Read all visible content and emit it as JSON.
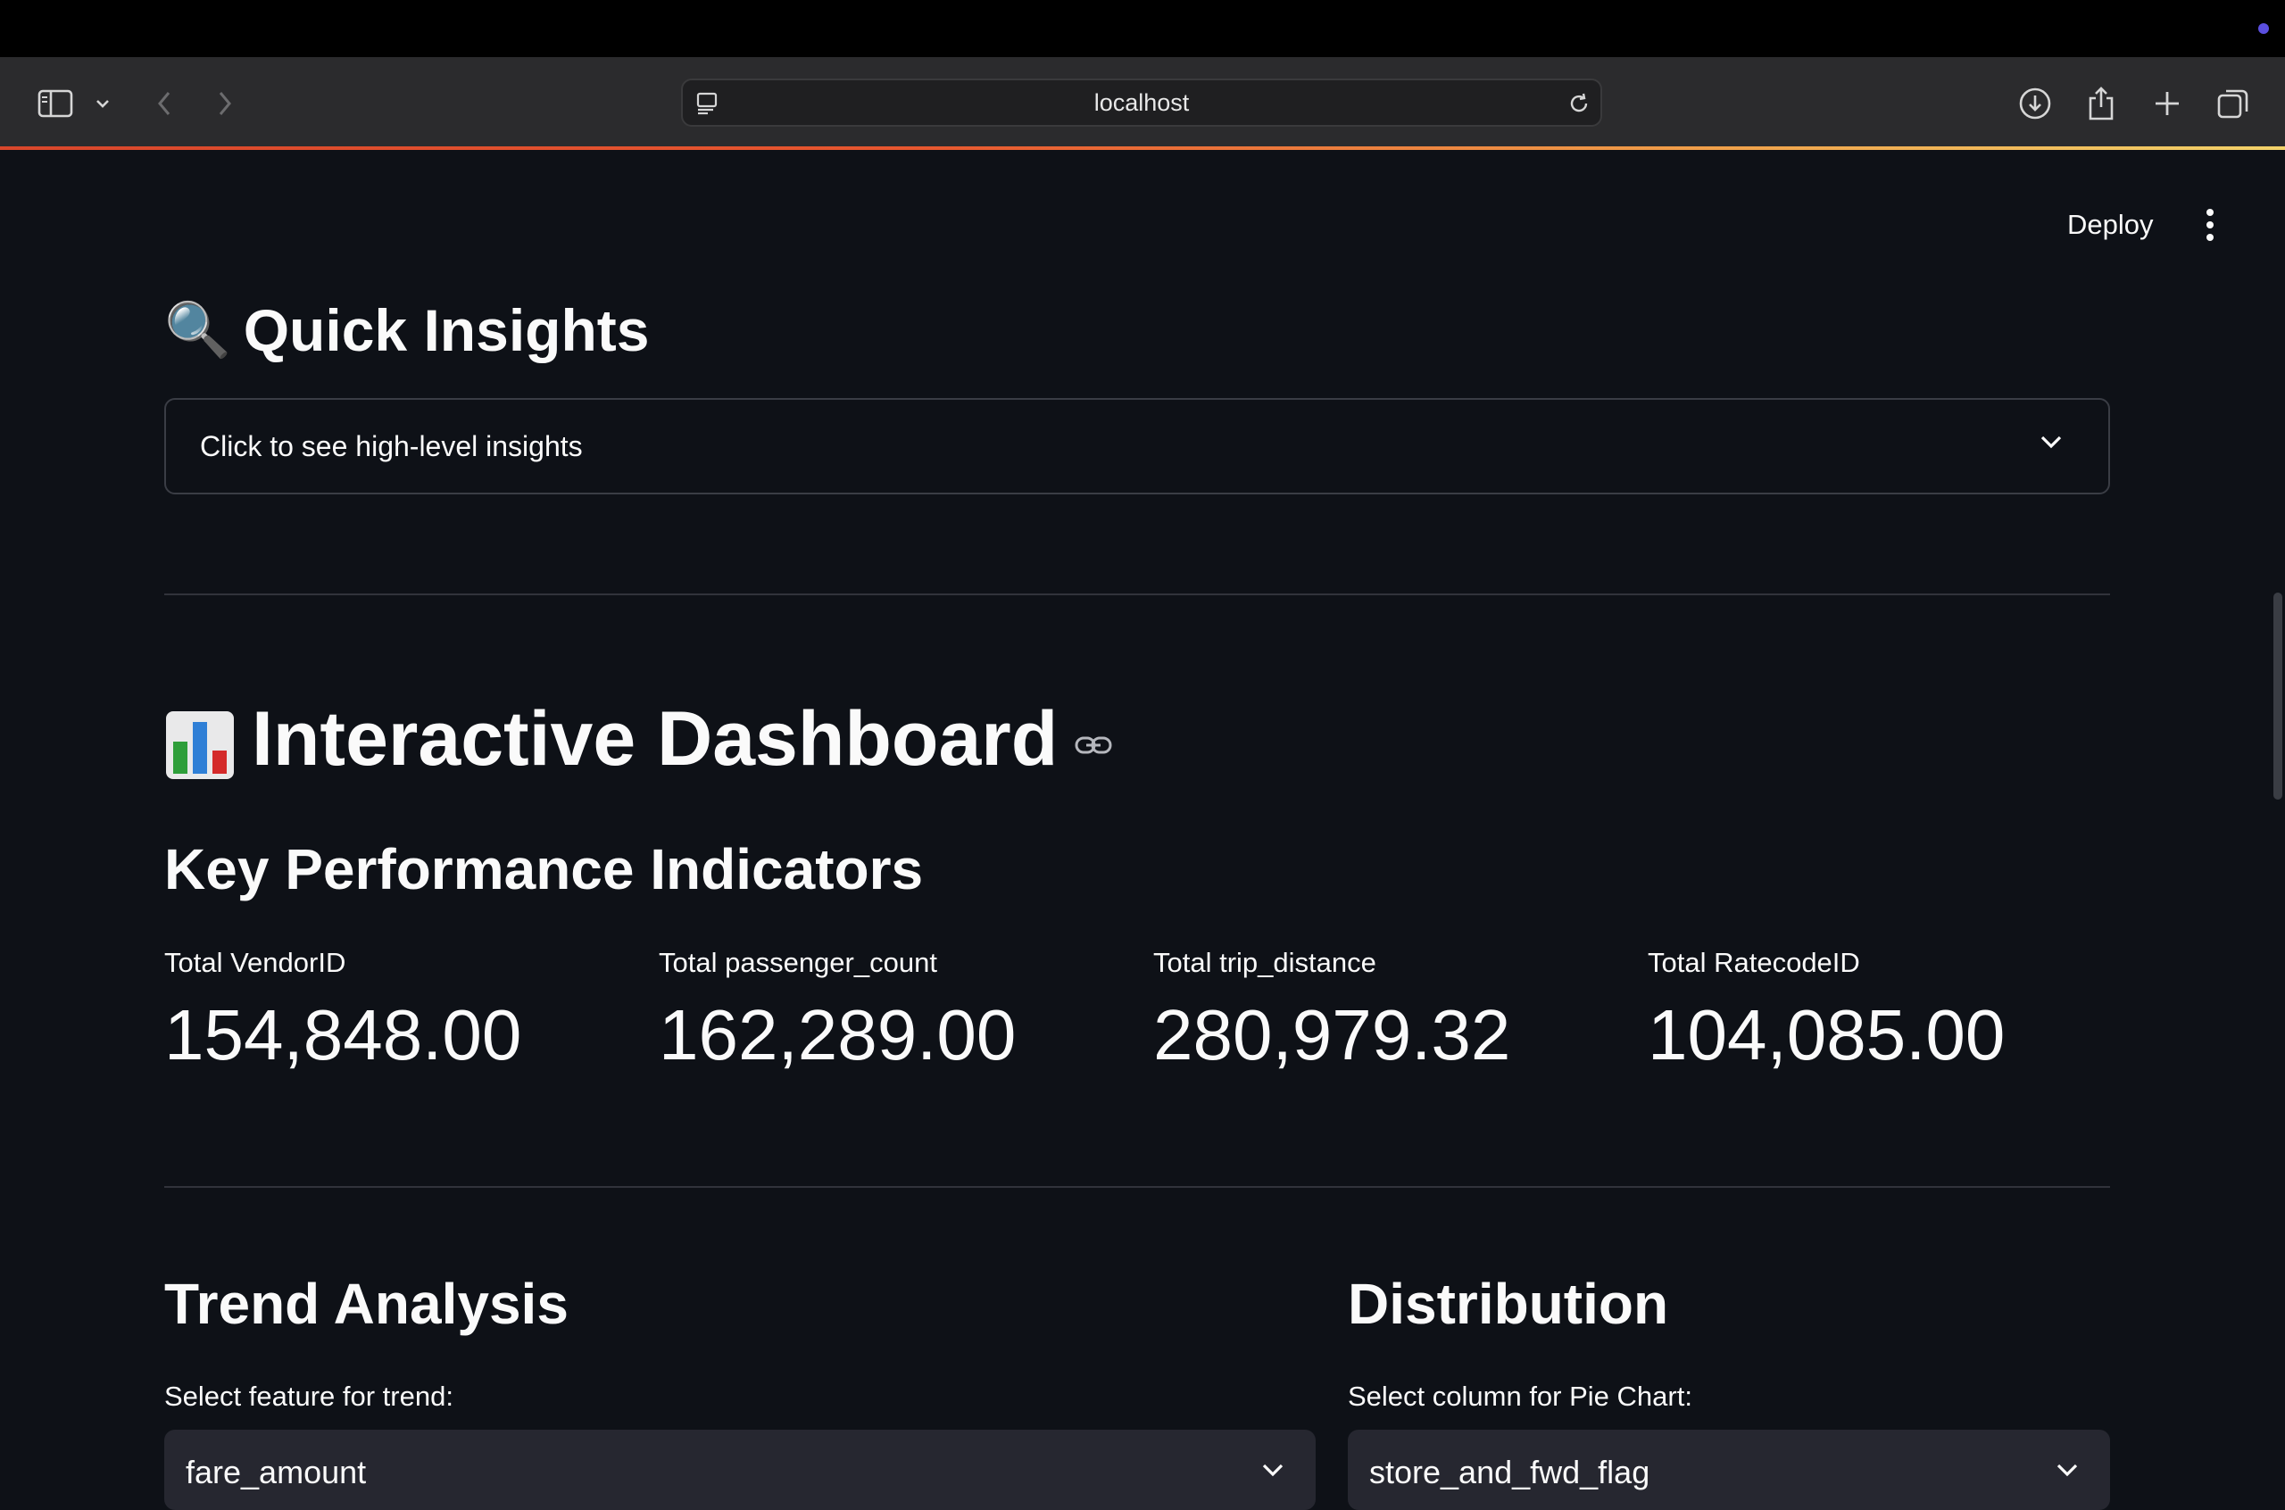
{
  "browser": {
    "url": "localhost",
    "icons": [
      "sidebar-icon",
      "chevron-down-icon",
      "back-icon",
      "forward-icon",
      "site-settings-icon",
      "reload-icon",
      "download-icon",
      "share-icon",
      "new-tab-icon",
      "tab-overview-icon"
    ]
  },
  "header": {
    "deploy_label": "Deploy",
    "menu_icon": "kebab-menu-icon"
  },
  "insights": {
    "emoji": "🔍",
    "title": "Quick Insights",
    "expander_label": "Click to see high-level insights"
  },
  "dashboard": {
    "emoji": "📊",
    "title": "Interactive Dashboard",
    "anchor_icon": "link-icon"
  },
  "kpi": {
    "title": "Key Performance Indicators",
    "items": [
      {
        "label": "Total VendorID",
        "value": "154,848.00"
      },
      {
        "label": "Total passenger_count",
        "value": "162,289.00"
      },
      {
        "label": "Total trip_distance",
        "value": "280,979.32"
      },
      {
        "label": "Total RatecodeID",
        "value": "104,085.00"
      }
    ]
  },
  "trend": {
    "title": "Trend Analysis",
    "select_label": "Select feature for trend:",
    "selected": "fare_amount"
  },
  "distribution": {
    "title": "Distribution",
    "select_label": "Select column for Pie Chart:",
    "selected": "store_and_fwd_flag"
  },
  "colors": {
    "background": "#0e1117",
    "text": "#fafafa",
    "chrome": "#2b2b2d",
    "select_bg": "#262730",
    "border": "#3a3d45"
  }
}
